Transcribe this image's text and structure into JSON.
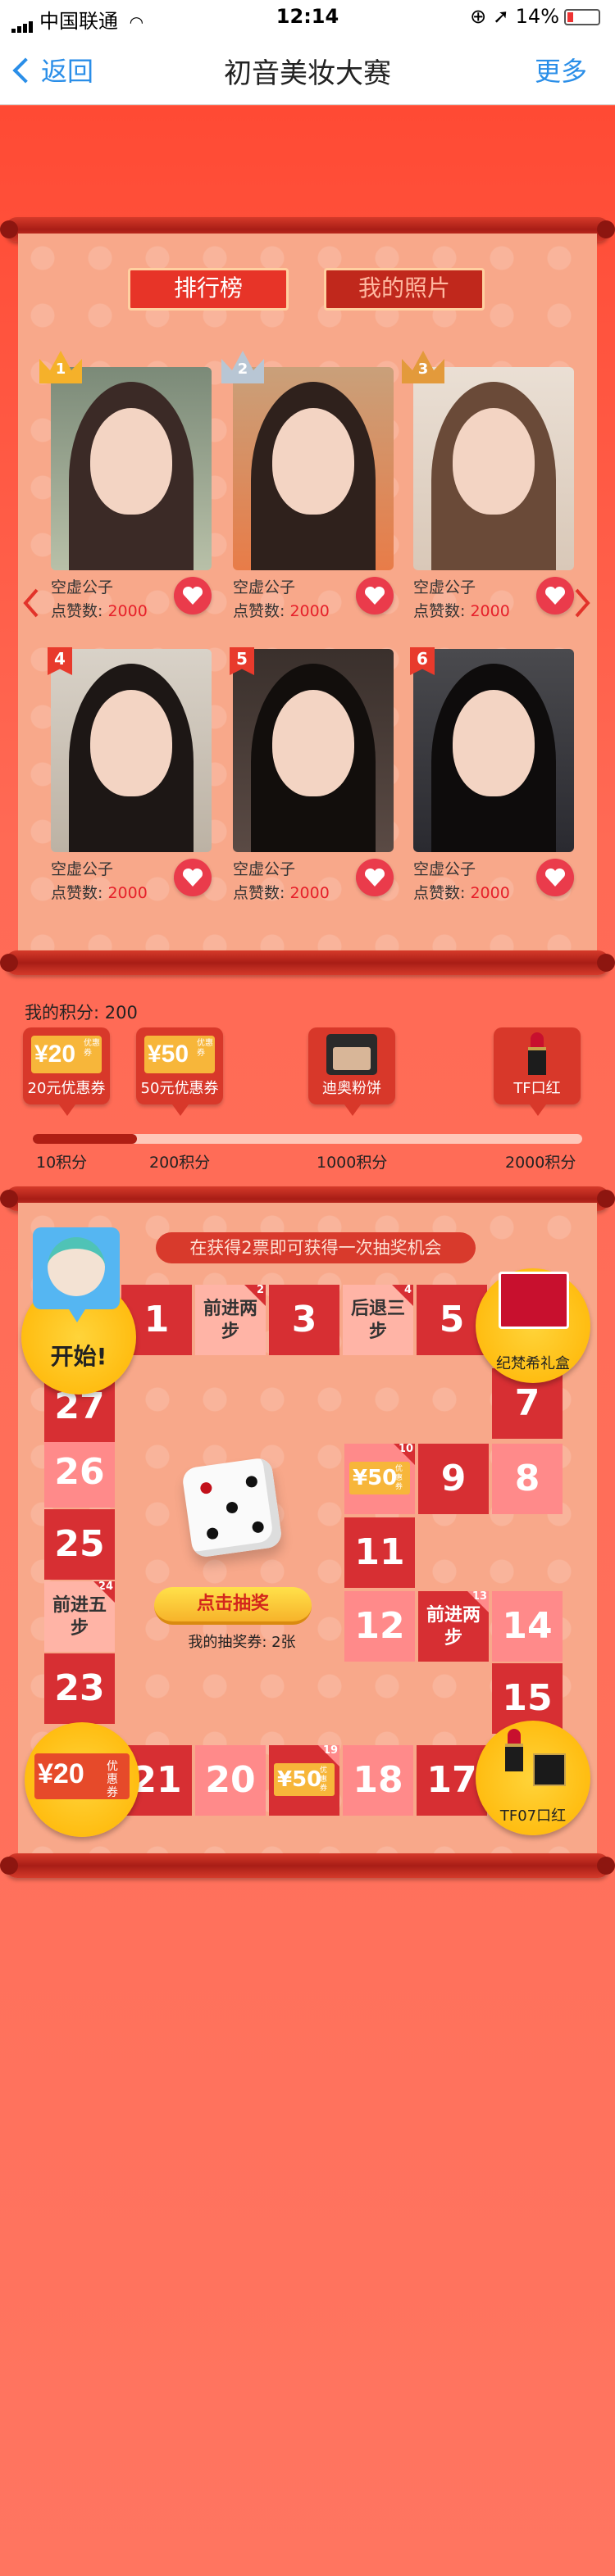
{
  "status": {
    "carrier": "中国联通",
    "time": "12:14",
    "battery": "14%"
  },
  "nav": {
    "back": "返回",
    "title": "初音美妆大赛",
    "more": "更多"
  },
  "tabs": {
    "ranking": "排行榜",
    "my_photos": "我的照片"
  },
  "contestants": [
    {
      "rank": "1",
      "name": "空虚公子",
      "likes_label": "点赞数:",
      "likes": "2000"
    },
    {
      "rank": "2",
      "name": "空虚公子",
      "likes_label": "点赞数:",
      "likes": "2000"
    },
    {
      "rank": "3",
      "name": "空虚公子",
      "likes_label": "点赞数:",
      "likes": "2000"
    },
    {
      "rank": "4",
      "name": "空虚公子",
      "likes_label": "点赞数:",
      "likes": "2000"
    },
    {
      "rank": "5",
      "name": "空虚公子",
      "likes_label": "点赞数:",
      "likes": "2000"
    },
    {
      "rank": "6",
      "name": "空虚公子",
      "likes_label": "点赞数:",
      "likes": "2000"
    }
  ],
  "points": {
    "label": "我的积分:",
    "value": "200",
    "progress": 0.19
  },
  "prizes": [
    {
      "label": "20元优惠券",
      "coupon": "¥20",
      "sub": "优惠券"
    },
    {
      "label": "50元优惠券",
      "coupon": "¥50",
      "sub": "优惠券"
    },
    {
      "label": "迪奥粉饼"
    },
    {
      "label": "TF口红"
    }
  ],
  "ticks": [
    "10积分",
    "200积分",
    "1000积分",
    "2000积分"
  ],
  "board": {
    "hint": "在获得2票即可获得一次抽奖机会",
    "start": "开始!",
    "gift_label": "纪梵希礼盒",
    "lipstick_label": "TF07口红",
    "coupon20": "¥20",
    "coupon20_sub": "优惠券",
    "coupon50": "¥50",
    "coupon50_sub": "优惠券",
    "draw_button": "点击抽奖",
    "tickets_label": "我的抽奖券:",
    "tickets": "2张",
    "cells": {
      "c1": "1",
      "c2": "前进两步",
      "c3": "3",
      "c4": "后退三步",
      "c5": "5",
      "c7": "7",
      "c8": "8",
      "c9": "9",
      "c11": "11",
      "c12": "12",
      "c13": "前进两步",
      "c14": "14",
      "c15": "15",
      "c17": "17",
      "c18": "18",
      "c20": "20",
      "c21": "21",
      "c23": "23",
      "c24": "前进五步",
      "c25": "25",
      "c26": "26",
      "c27": "27",
      "n2": "2",
      "n4": "4",
      "n10": "10",
      "n13": "13",
      "n19": "19",
      "n24": "24"
    }
  }
}
